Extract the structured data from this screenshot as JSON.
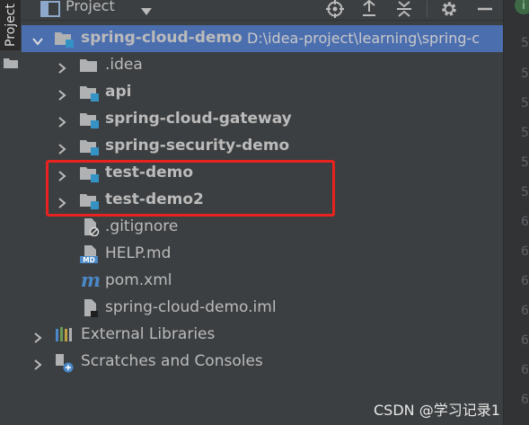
{
  "side_tab": {
    "label": "Project"
  },
  "header": {
    "title": "Project"
  },
  "tree": {
    "root": {
      "name": "spring-cloud-demo",
      "path": "D:\\idea-project\\learning\\spring-c"
    },
    "modules": [
      {
        "name": ".idea"
      },
      {
        "name": "api"
      },
      {
        "name": "spring-cloud-gateway"
      },
      {
        "name": "spring-security-demo"
      },
      {
        "name": "test-demo"
      },
      {
        "name": "test-demo2"
      }
    ],
    "files": [
      {
        "name": ".gitignore"
      },
      {
        "name": "HELP.md",
        "icon_text": "MD"
      },
      {
        "name": "pom.xml",
        "icon_text": "m"
      },
      {
        "name": "spring-cloud-demo.iml"
      }
    ],
    "external_libraries": "External Libraries",
    "scratches": "Scratches and Consoles"
  },
  "gutter": {
    "badge": "i",
    "line_numbers": [
      "5",
      "5",
      "5",
      "5",
      "5",
      "5",
      "6",
      "6",
      "6",
      "6",
      "6",
      "6",
      "6",
      "6",
      "6"
    ]
  },
  "watermark": "CSDN @学习记录1",
  "colors": {
    "panel_bg": "#3c3f41",
    "selection": "#4b6eaf",
    "highlight_box": "#e8231f",
    "module_badge": "#3592c4",
    "text": "#bbbbbb"
  }
}
